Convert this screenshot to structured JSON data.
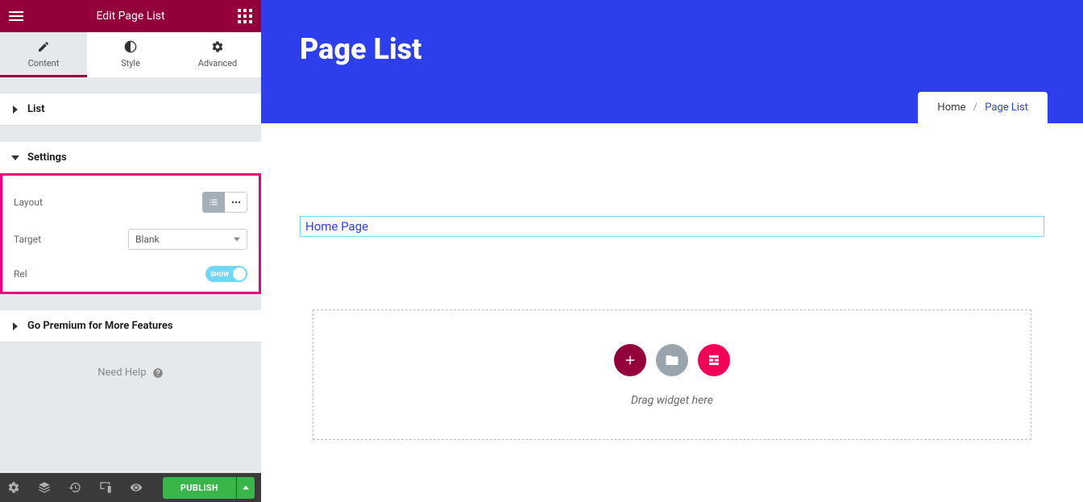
{
  "panel": {
    "title": "Edit Page List",
    "tabs": {
      "content": "Content",
      "style": "Style",
      "advanced": "Advanced"
    },
    "sections": {
      "list": "List",
      "settings": "Settings",
      "premium": "Go Premium for More Features"
    },
    "settings": {
      "layout_label": "Layout",
      "target_label": "Target",
      "target_value": "Blank",
      "rel_label": "Rel",
      "rel_switch_label": "SHOW"
    },
    "need_help": "Need Help",
    "publish": "Publish"
  },
  "preview": {
    "hero_title": "Page List",
    "breadcrumb": {
      "home": "Home",
      "separator": "/",
      "current": "Page List"
    },
    "widget_text": "Home Page",
    "dropzone_label": "Drag widget here"
  }
}
